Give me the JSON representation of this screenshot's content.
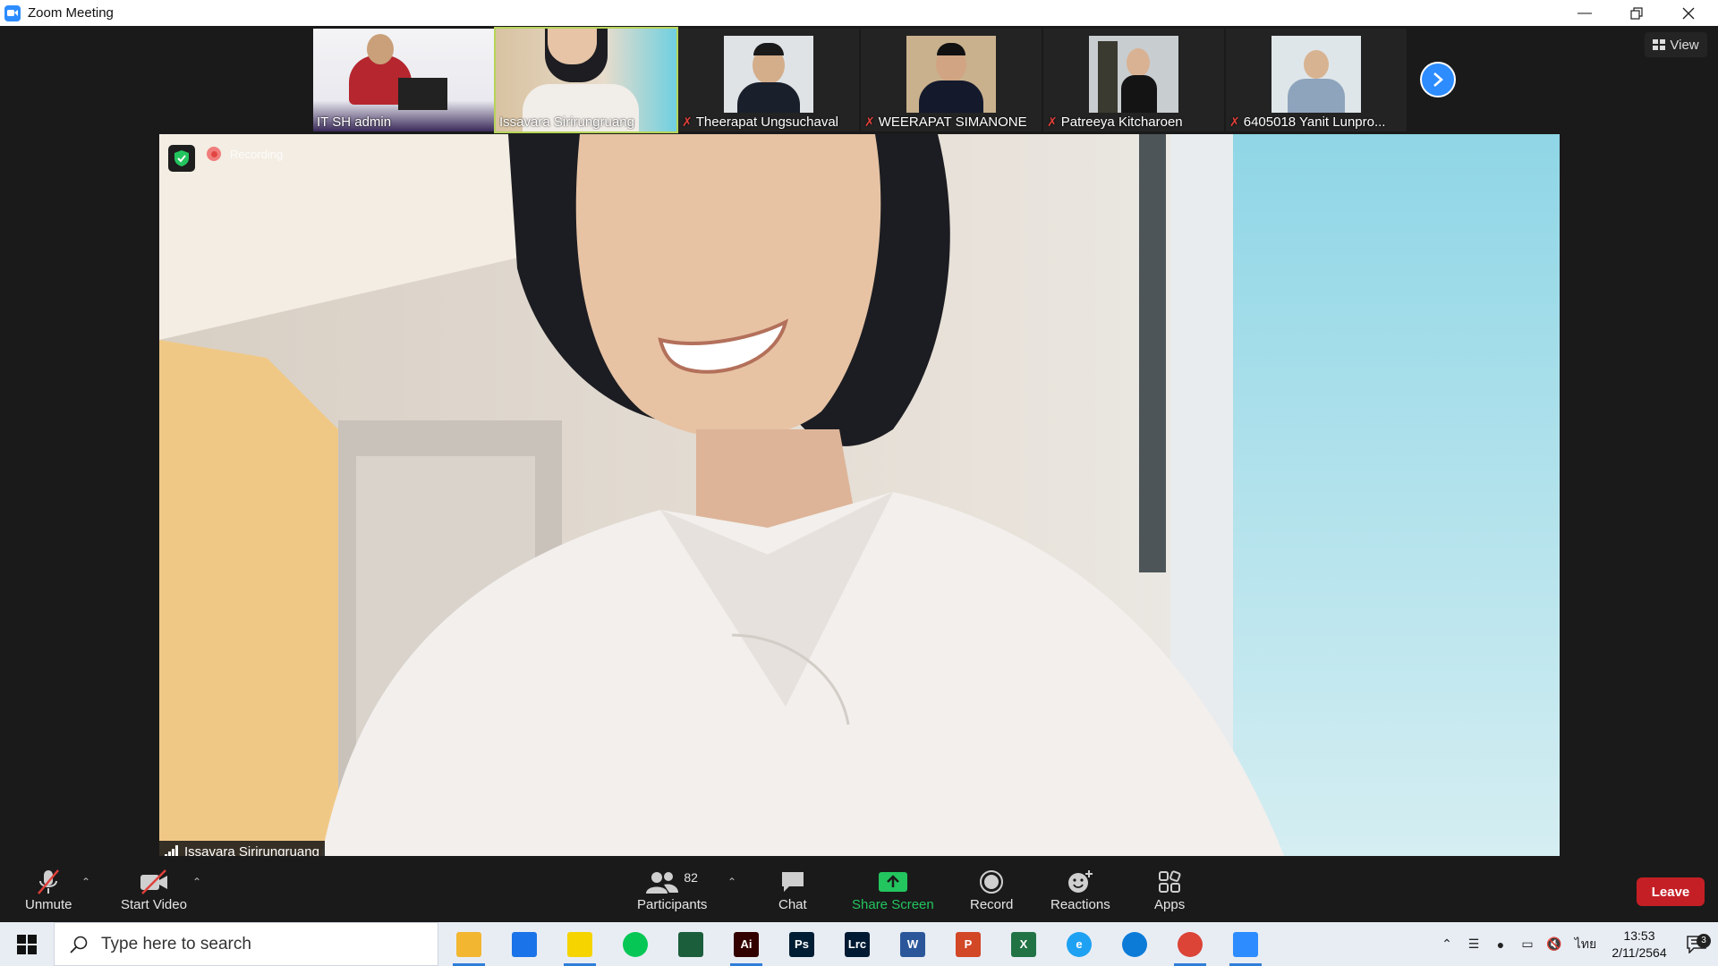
{
  "window": {
    "title": "Zoom Meeting"
  },
  "thumbnails": [
    {
      "name": "IT SH admin",
      "muted": false
    },
    {
      "name": "Issavara Sirirungruang",
      "muted": false,
      "active": true
    },
    {
      "name": "Theerapat Ungsuchaval",
      "muted": true
    },
    {
      "name": "WEERAPAT SIMANONE",
      "muted": true
    },
    {
      "name": "Patreeya Kitcharoen",
      "muted": true
    },
    {
      "name": "6405018 Yanit Lunpro...",
      "muted": true
    }
  ],
  "view_button": "View",
  "main_video": {
    "recording_label": "Recording",
    "speaker_name": "Issavara Sirirungruang"
  },
  "toolbar": {
    "unmute": "Unmute",
    "start_video": "Start Video",
    "participants": "Participants",
    "participants_count": "82",
    "chat": "Chat",
    "share_screen": "Share Screen",
    "record": "Record",
    "reactions": "Reactions",
    "apps": "Apps",
    "leave": "Leave"
  },
  "taskbar": {
    "search_placeholder": "Type here to search",
    "apps": [
      {
        "icon": "file-explorer-icon",
        "color": "#f2b630",
        "label": ""
      },
      {
        "icon": "mail-icon",
        "color": "#1a73e8",
        "label": ""
      },
      {
        "icon": "sticky-notes-icon",
        "color": "#f5d400",
        "label": ""
      },
      {
        "icon": "line-icon",
        "color": "#06c755",
        "label": ""
      },
      {
        "icon": "app-s-icon",
        "color": "#1b5e3b",
        "label": ""
      },
      {
        "icon": "illustrator-icon",
        "color": "#330000",
        "label": "Ai"
      },
      {
        "icon": "photoshop-icon",
        "color": "#001d34",
        "label": "Ps"
      },
      {
        "icon": "lightroom-classic-icon",
        "color": "#001a33",
        "label": "Lrc"
      },
      {
        "icon": "word-icon",
        "color": "#2b579a",
        "label": "W"
      },
      {
        "icon": "powerpoint-icon",
        "color": "#d24726",
        "label": "P"
      },
      {
        "icon": "excel-icon",
        "color": "#217346",
        "label": "X"
      },
      {
        "icon": "internet-explorer-icon",
        "color": "#1ea1f2",
        "label": "e"
      },
      {
        "icon": "edge-icon",
        "color": "#0c7bd8",
        "label": ""
      },
      {
        "icon": "chrome-icon",
        "color": "#db4437",
        "label": ""
      },
      {
        "icon": "zoom-icon",
        "color": "#2d8cff",
        "label": ""
      }
    ],
    "input_language": "ไทย",
    "time": "13:53",
    "date": "2/11/2564",
    "notification_count": "3"
  }
}
